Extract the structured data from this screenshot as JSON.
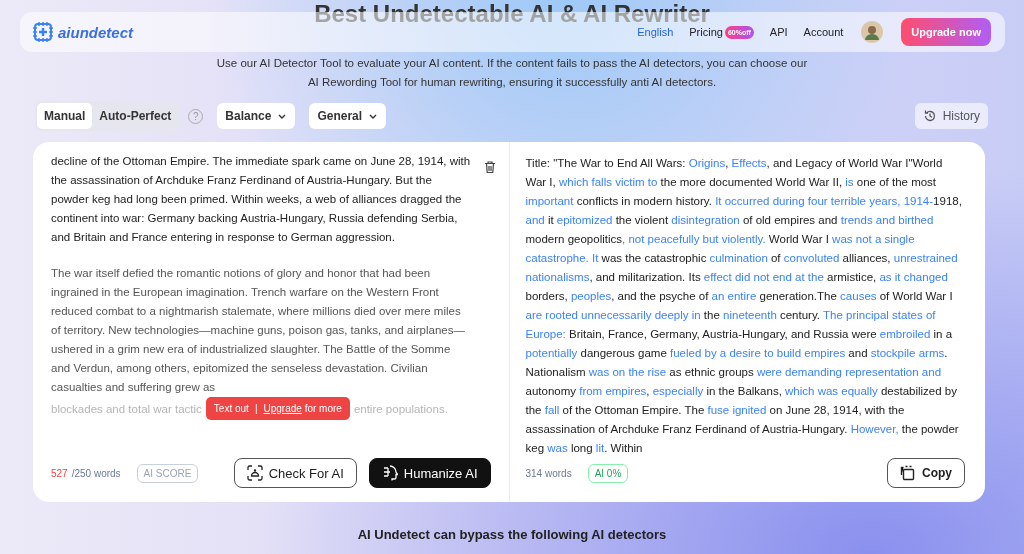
{
  "page": {
    "heading": "Best Undetectable AI & AI Rewriter",
    "subtitle_lines": [
      "Use our AI Detector Tool to evaluate your AI content. If the content fails to pass the AI detectors, you can choose our",
      "AI Rewording Tool for human rewriting, ensuring it successfully anti AI detectors."
    ]
  },
  "nav": {
    "logo": "aiundetect",
    "language": "English",
    "pricing": {
      "label": "Pricing",
      "badge": "60%off"
    },
    "api": "API",
    "account": "Account",
    "upgrade": "Upgrade now"
  },
  "modes": [
    {
      "label": "Manual",
      "selected": true
    },
    {
      "label": "Auto-Perfect",
      "selected": false
    }
  ],
  "help": "?",
  "dropdowns": [
    "Balance",
    "General"
  ],
  "history": "History",
  "input": {
    "paragraphs": [
      "decline of the Ottoman Empire. The immediate spark came on June 28, 1914, with the assassination of Archduke Franz Ferdinand of Austria-Hungary. But the powder keg had long been primed. Within weeks, a web of alliances dragged the continent into war: Germany backing Austria-Hungary, Russia defending Serbia, and Britain and France entering in response to German aggression.",
      "The war itself defied the romantic notions of glory and honor that had been ingrained in the European imagination. Trench warfare on the Western Front reduced combat to a nightmarish stalemate, where millions died over mere miles of territory. New technologies—machine guns, poison gas, tanks, and airplanes—ushered in a grim new era of industrialized slaughter. The Battle of the Somme and Verdun, among others, epitomized the senseless devastation. Civilian casualties and suffering grew as"
    ],
    "last_line": [
      "blockades and total war tactic",
      "entire populations."
    ],
    "toast": {
      "text": "Text out",
      "separator": "|",
      "link": "Upgrade",
      "suffix": "for more"
    },
    "word_count": "527",
    "word_limit": "/250 words",
    "over_limit": true,
    "score_badge": "AI SCORE",
    "buttons": [
      "Check For AI",
      "Humanize AI"
    ]
  },
  "output": {
    "segments": [
      {
        "text": "Title: \"The War to End All Wars: ",
        "changed": false
      },
      {
        "text": "Origins",
        "changed": true
      },
      {
        "text": ", ",
        "changed": false
      },
      {
        "text": "Effects",
        "changed": true
      },
      {
        "text": ", and Legacy of World War I\"World War I, ",
        "changed": false
      },
      {
        "text": "which falls victim to",
        "changed": true
      },
      {
        "text": " the more documented World War II, ",
        "changed": false
      },
      {
        "text": "is",
        "changed": true
      },
      {
        "text": " one of the most ",
        "changed": false
      },
      {
        "text": "important",
        "changed": true
      },
      {
        "text": " conflicts in modern history. ",
        "changed": false
      },
      {
        "text": "It occurred during four terrible years, 1914-",
        "changed": true
      },
      {
        "text": "1918, ",
        "changed": false
      },
      {
        "text": "and",
        "changed": true
      },
      {
        "text": " it ",
        "changed": false
      },
      {
        "text": "epitomized",
        "changed": true
      },
      {
        "text": " the violent ",
        "changed": false
      },
      {
        "text": "disintegration",
        "changed": true
      },
      {
        "text": " of old empires and ",
        "changed": false
      },
      {
        "text": "trends and birthed",
        "changed": true
      },
      {
        "text": " modern geopolitics",
        "changed": false
      },
      {
        "text": ", not peacefully but violently.",
        "changed": true
      },
      {
        "text": " World War I ",
        "changed": false
      },
      {
        "text": "was not a single catastrophe. It",
        "changed": true
      },
      {
        "text": " was the catastrophic ",
        "changed": false
      },
      {
        "text": "culmination",
        "changed": true
      },
      {
        "text": " of ",
        "changed": false
      },
      {
        "text": "convoluted",
        "changed": true
      },
      {
        "text": " alliances, ",
        "changed": false
      },
      {
        "text": "unrestrained nationalisms",
        "changed": true
      },
      {
        "text": ", and militarization. Its ",
        "changed": false
      },
      {
        "text": "effect did not end at the",
        "changed": true
      },
      {
        "text": " armistice, ",
        "changed": false
      },
      {
        "text": "as it changed",
        "changed": true
      },
      {
        "text": " borders, ",
        "changed": false
      },
      {
        "text": "peoples",
        "changed": true
      },
      {
        "text": ", and the psyche of ",
        "changed": false
      },
      {
        "text": "an entire",
        "changed": true
      },
      {
        "text": " generation.The ",
        "changed": false
      },
      {
        "text": "causes",
        "changed": true
      },
      {
        "text": " of World War I ",
        "changed": false
      },
      {
        "text": "are rooted unnecessarily deeply in",
        "changed": true
      },
      {
        "text": " the ",
        "changed": false
      },
      {
        "text": "nineteenth",
        "changed": true
      },
      {
        "text": " century. ",
        "changed": false
      },
      {
        "text": "The principal states of Europe:",
        "changed": true
      },
      {
        "text": " Britain, France, Germany, Austria-Hungary, and Russia were ",
        "changed": false
      },
      {
        "text": "embroiled",
        "changed": true
      },
      {
        "text": " in a ",
        "changed": false
      },
      {
        "text": "potentially",
        "changed": true
      },
      {
        "text": " dangerous game ",
        "changed": false
      },
      {
        "text": "fueled by a desire to build empires",
        "changed": true
      },
      {
        "text": " and ",
        "changed": false
      },
      {
        "text": "stockpile arms",
        "changed": true
      },
      {
        "text": ". Nationalism ",
        "changed": false
      },
      {
        "text": "was on the rise",
        "changed": true
      },
      {
        "text": " as ethnic groups ",
        "changed": false
      },
      {
        "text": "were demanding representation and",
        "changed": true
      },
      {
        "text": " autonomy ",
        "changed": false
      },
      {
        "text": "from empires",
        "changed": true
      },
      {
        "text": ", ",
        "changed": false
      },
      {
        "text": "especially",
        "changed": true
      },
      {
        "text": " in the Balkans, ",
        "changed": false
      },
      {
        "text": "which was equally",
        "changed": true
      },
      {
        "text": " destabilized by the ",
        "changed": false
      },
      {
        "text": "fall",
        "changed": true
      },
      {
        "text": " of the Ottoman Empire. The ",
        "changed": false
      },
      {
        "text": "fuse ignited",
        "changed": true
      },
      {
        "text": " on June 28, 1914, with the assassination of Archduke Franz Ferdinand of Austria-Hungary. ",
        "changed": false
      },
      {
        "text": "However,",
        "changed": true
      },
      {
        "text": " the powder keg ",
        "changed": false
      },
      {
        "text": "was",
        "changed": true
      },
      {
        "text": " long ",
        "changed": false
      },
      {
        "text": "lit",
        "changed": true
      },
      {
        "text": ". Within",
        "changed": false
      }
    ],
    "word_count": "314 words",
    "ai_badge": "AI 0%",
    "copy": "Copy"
  },
  "footer_heading": "AI Undetect can bypass the following AI detectors"
}
